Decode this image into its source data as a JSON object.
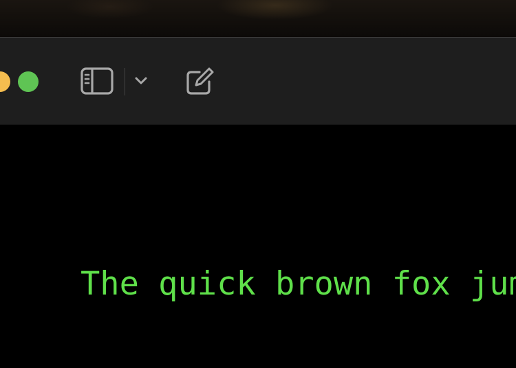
{
  "window": {
    "toolbar": {
      "buttons": [
        {
          "name": "sidebar-toggle",
          "icon": "sidebar-icon"
        },
        {
          "name": "sidebar-options",
          "icon": "chevron-down-icon"
        },
        {
          "name": "new-note",
          "icon": "compose-icon"
        }
      ]
    },
    "editor": {
      "text": "The quick brown fox jumps over the lazy dog"
    }
  },
  "colors": {
    "toolbar_bg": "#1e1e1e",
    "editor_bg": "#000000",
    "text_green": "#5fe04a",
    "traffic_yellow": "#f5bd4f",
    "traffic_green": "#5fc454",
    "icon_gray": "#a8a8a8"
  }
}
